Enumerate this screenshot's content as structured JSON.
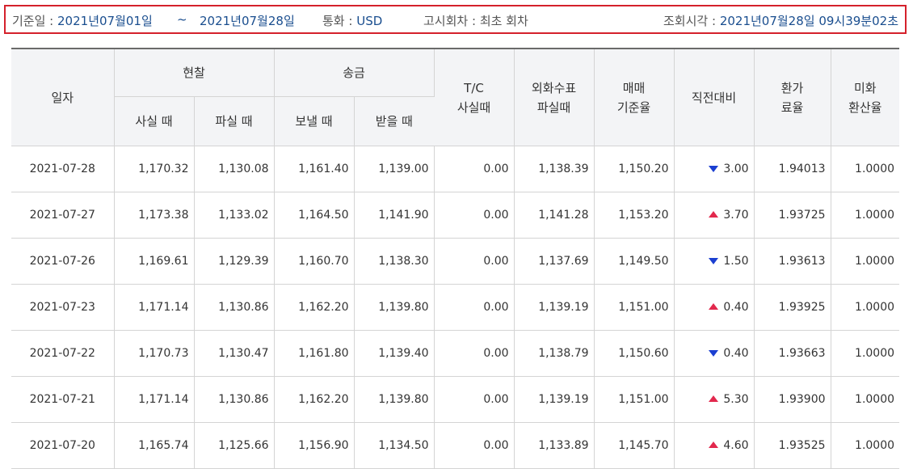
{
  "filters": {
    "base_date_label": "기준일 :",
    "start_date": "2021년07월01일",
    "tilde": "~",
    "end_date": "2021년07월28일",
    "currency_label": "통화 :",
    "currency": "USD",
    "round_label": "고시회차 :",
    "round": "최초 회차",
    "query_time_label": "조회시각 :",
    "query_time": "2021년07월28일 09시39분02초"
  },
  "colors": {
    "border_highlight": "#d5212b",
    "value_text": "#1a4e8f",
    "up": "#e2284d",
    "down": "#1b3fd1"
  },
  "table": {
    "headers": {
      "date": "일자",
      "cash": "현찰",
      "cash_buy": "사실 때",
      "cash_sell": "파실 때",
      "transfer": "송금",
      "send": "보낼 때",
      "receive": "받을 때",
      "tc_line1": "T/C",
      "tc_line2": "사실때",
      "check_line1": "외화수표",
      "check_line2": "파실때",
      "base_line1": "매매",
      "base_line2": "기준율",
      "change": "직전대비",
      "fee_line1": "환가",
      "fee_line2": "료율",
      "usd_line1": "미화",
      "usd_line2": "환산율"
    },
    "rows": [
      {
        "date": "2021-07-28",
        "cash_buy": "1,170.32",
        "cash_sell": "1,130.08",
        "send": "1,161.40",
        "receive": "1,139.00",
        "tc": "0.00",
        "check": "1,138.39",
        "base": "1,150.20",
        "direction": "down",
        "change": "3.00",
        "fee_rate": "1.94013",
        "usd_rate": "1.0000"
      },
      {
        "date": "2021-07-27",
        "cash_buy": "1,173.38",
        "cash_sell": "1,133.02",
        "send": "1,164.50",
        "receive": "1,141.90",
        "tc": "0.00",
        "check": "1,141.28",
        "base": "1,153.20",
        "direction": "up",
        "change": "3.70",
        "fee_rate": "1.93725",
        "usd_rate": "1.0000"
      },
      {
        "date": "2021-07-26",
        "cash_buy": "1,169.61",
        "cash_sell": "1,129.39",
        "send": "1,160.70",
        "receive": "1,138.30",
        "tc": "0.00",
        "check": "1,137.69",
        "base": "1,149.50",
        "direction": "down",
        "change": "1.50",
        "fee_rate": "1.93613",
        "usd_rate": "1.0000"
      },
      {
        "date": "2021-07-23",
        "cash_buy": "1,171.14",
        "cash_sell": "1,130.86",
        "send": "1,162.20",
        "receive": "1,139.80",
        "tc": "0.00",
        "check": "1,139.19",
        "base": "1,151.00",
        "direction": "up",
        "change": "0.40",
        "fee_rate": "1.93925",
        "usd_rate": "1.0000"
      },
      {
        "date": "2021-07-22",
        "cash_buy": "1,170.73",
        "cash_sell": "1,130.47",
        "send": "1,161.80",
        "receive": "1,139.40",
        "tc": "0.00",
        "check": "1,138.79",
        "base": "1,150.60",
        "direction": "down",
        "change": "0.40",
        "fee_rate": "1.93663",
        "usd_rate": "1.0000"
      },
      {
        "date": "2021-07-21",
        "cash_buy": "1,171.14",
        "cash_sell": "1,130.86",
        "send": "1,162.20",
        "receive": "1,139.80",
        "tc": "0.00",
        "check": "1,139.19",
        "base": "1,151.00",
        "direction": "up",
        "change": "5.30",
        "fee_rate": "1.93900",
        "usd_rate": "1.0000"
      },
      {
        "date": "2021-07-20",
        "cash_buy": "1,165.74",
        "cash_sell": "1,125.66",
        "send": "1,156.90",
        "receive": "1,134.50",
        "tc": "0.00",
        "check": "1,133.89",
        "base": "1,145.70",
        "direction": "up",
        "change": "4.60",
        "fee_rate": "1.93525",
        "usd_rate": "1.0000"
      }
    ]
  }
}
